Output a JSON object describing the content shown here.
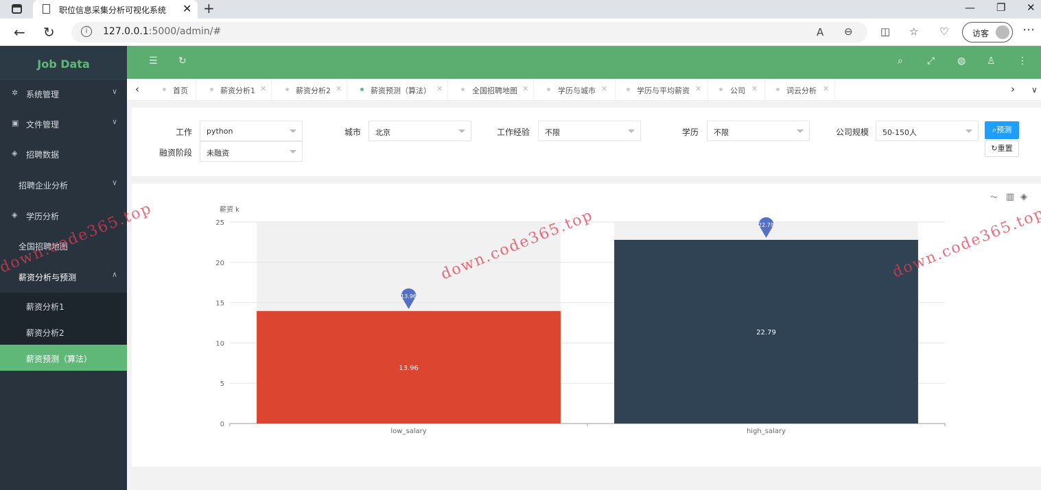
{
  "browser": {
    "tab_title": "职位信息采集分析可视化系统",
    "url_host": "127.0.0.1",
    "url_rest": ":5000/admin/#",
    "guest_label": "访客"
  },
  "sidebar": {
    "logo": "Job Data",
    "items": [
      {
        "label": "系统管理"
      },
      {
        "label": "文件管理"
      },
      {
        "label": "招聘数据"
      },
      {
        "label": "招聘企业分析"
      },
      {
        "label": "学历分析"
      },
      {
        "label": "全国招聘地图"
      },
      {
        "label": "薪资分析与预测"
      }
    ],
    "sub_items": [
      {
        "label": "薪资分析1"
      },
      {
        "label": "薪资分析2"
      },
      {
        "label": "薪资预测（算法）"
      }
    ]
  },
  "tabs": [
    {
      "label": "首页"
    },
    {
      "label": "薪资分析1"
    },
    {
      "label": "薪资分析2"
    },
    {
      "label": "薪资预测（算法）"
    },
    {
      "label": "全国招聘地图"
    },
    {
      "label": "学历与城市"
    },
    {
      "label": "学历与平均薪资"
    },
    {
      "label": "公司"
    },
    {
      "label": "词云分析"
    }
  ],
  "form": {
    "job_label": "工作",
    "job_value": "python",
    "city_label": "城市",
    "city_value": "北京",
    "exp_label": "工作经验",
    "exp_value": "不限",
    "edu_label": "学历",
    "edu_value": "不限",
    "size_label": "公司规模",
    "size_value": "50-150人",
    "fund_label": "融资阶段",
    "fund_value": "未融资",
    "predict_label": "预测",
    "reset_label": "重置"
  },
  "chart_data": {
    "type": "bar",
    "categories": [
      "low_salary",
      "high_salary"
    ],
    "values": [
      13.96,
      22.79
    ],
    "colors": [
      "#dc4530",
      "#2f4355"
    ],
    "ylabel": "薪资 k",
    "ylim": [
      0,
      25
    ],
    "yticks": [
      0,
      5,
      10,
      15,
      20,
      25
    ],
    "markers": "max pins above bars",
    "grid": true
  },
  "watermark": "down.code365.top"
}
